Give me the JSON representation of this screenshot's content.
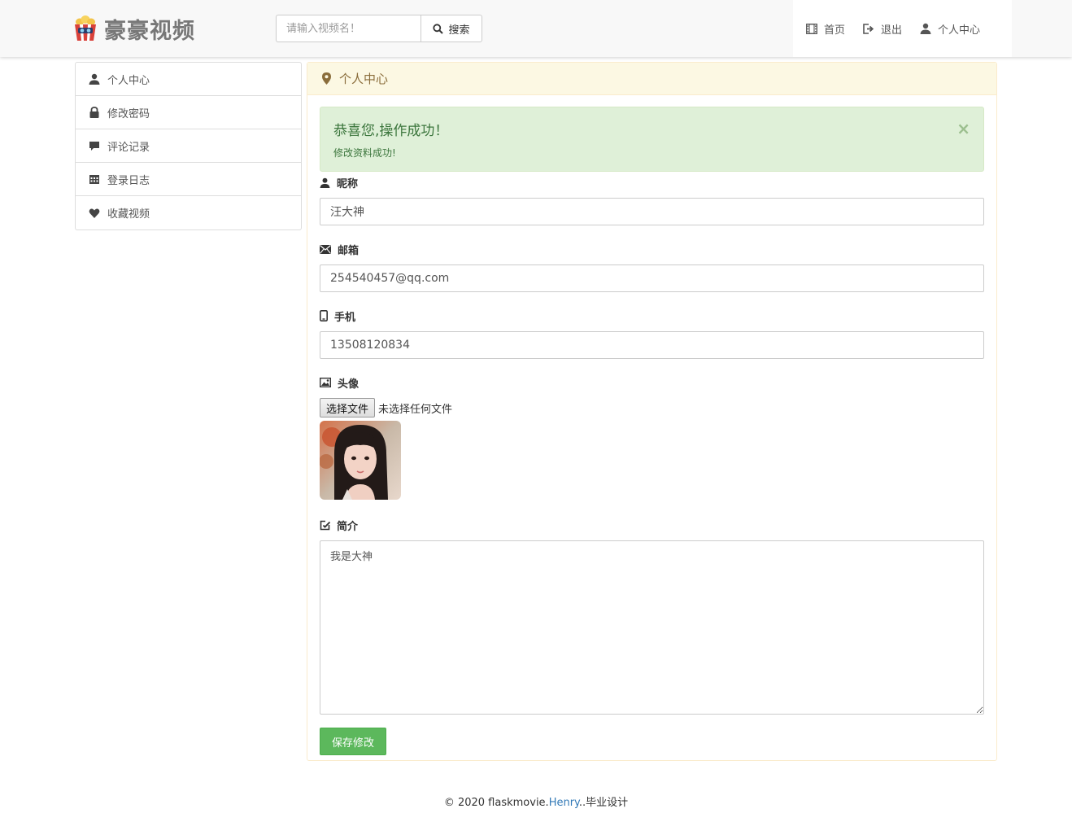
{
  "header": {
    "brand": "豪豪视频",
    "search": {
      "placeholder": "请输入视频名！",
      "button_label": "搜索"
    },
    "nav": [
      {
        "icon": "film-icon",
        "label": "首页"
      },
      {
        "icon": "logout-icon",
        "label": "退出"
      },
      {
        "icon": "user-icon",
        "label": "个人中心"
      }
    ]
  },
  "sidebar": {
    "items": [
      {
        "icon": "user-icon",
        "label": "个人中心"
      },
      {
        "icon": "lock-icon",
        "label": "修改密码"
      },
      {
        "icon": "comment-icon",
        "label": "评论记录"
      },
      {
        "icon": "calendar-icon",
        "label": "登录日志"
      },
      {
        "icon": "heart-icon",
        "label": "收藏视频"
      }
    ]
  },
  "panel": {
    "title": "个人中心",
    "alert": {
      "title": "恭喜您,操作成功！",
      "message": "修改资料成功!",
      "close": "×"
    },
    "form": {
      "nickname": {
        "label": "昵称",
        "value": "汪大神"
      },
      "email": {
        "label": "邮箱",
        "value": "254540457@qq.com"
      },
      "phone": {
        "label": "手机",
        "value": "13508120834"
      },
      "avatar": {
        "label": "头像",
        "file_button": "选择文件",
        "file_status": "未选择任何文件"
      },
      "intro": {
        "label": "简介",
        "value": "我是大神"
      },
      "save_label": "保存修改"
    }
  },
  "footer": {
    "prefix": "© 2020 flaskmovie.",
    "link": "Henry",
    "suffix": "..毕业设计"
  },
  "colors": {
    "success": "#5cb85c",
    "alert_bg": "#dff0d8",
    "panel_heading_bg": "#fcf8e3",
    "link": "#337ab7"
  }
}
